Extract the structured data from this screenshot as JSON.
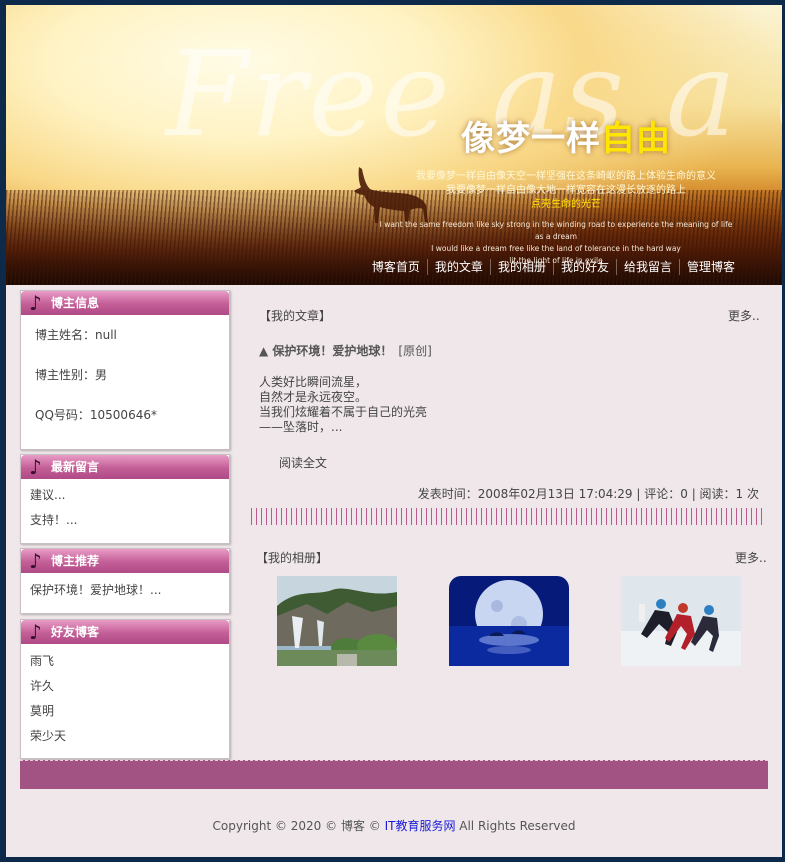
{
  "banner": {
    "script_text": "Free as a dr",
    "headline_a": "像梦一样",
    "headline_b": "自由",
    "cn_line1": "我要像梦一样自由像天空一样坚强在这条崎岖的路上体验生命的意义",
    "cn_line2": "我要像梦一样自由像大地一样宽容在这漫长放逐的路上",
    "cn_line3": "点亮生命的光芒",
    "en_line1": "I want the same freedom like sky strong in the winding road to experience the meaning of life as a dream",
    "en_line2": "I would like a dream free like the land of tolerance in the hard way",
    "en_line3": "lit the light of life in exile"
  },
  "nav": [
    {
      "label": "博客首页"
    },
    {
      "label": "我的文章"
    },
    {
      "label": "我的相册"
    },
    {
      "label": "我的好友"
    },
    {
      "label": "给我留言"
    },
    {
      "label": "管理博客"
    }
  ],
  "sidebar": {
    "info": {
      "title": "博主信息",
      "rows": [
        "博主姓名：null",
        "博主性别：男",
        "QQ号码：10500646*"
      ]
    },
    "messages": {
      "title": "最新留言",
      "items": [
        "建议...",
        "支持！..."
      ]
    },
    "recommend": {
      "title": "博主推荐",
      "items": [
        "保护环境！爱护地球！..."
      ]
    },
    "friends": {
      "title": "好友博客",
      "items": [
        "雨飞",
        "许久",
        "莫明",
        "荣少天"
      ]
    }
  },
  "articles": {
    "heading": "【我的文章】",
    "more": "更多..",
    "title": "▲ 保护环境！爱护地球！",
    "original": "[原创]",
    "body": "人类好比瞬间流星，\n自然才是永远夜空。\n当我们炫耀着不属于自己的光亮\n——坠落时，...",
    "read_all": "阅读全文",
    "meta": "发表时间：2008年02月13日 17:04:29 | 评论：0 | 阅读：1 次"
  },
  "album": {
    "heading": "【我的相册】",
    "more": "更多.."
  },
  "footer": {
    "prefix": "Copyright © 2020 © 博客 © ",
    "link": "IT教育服务网",
    "suffix": " All Rights Reserved"
  },
  "colors": {
    "accent": "#b04a86",
    "footer_bar": "#a25383",
    "page_bg": "#efe7ea"
  }
}
